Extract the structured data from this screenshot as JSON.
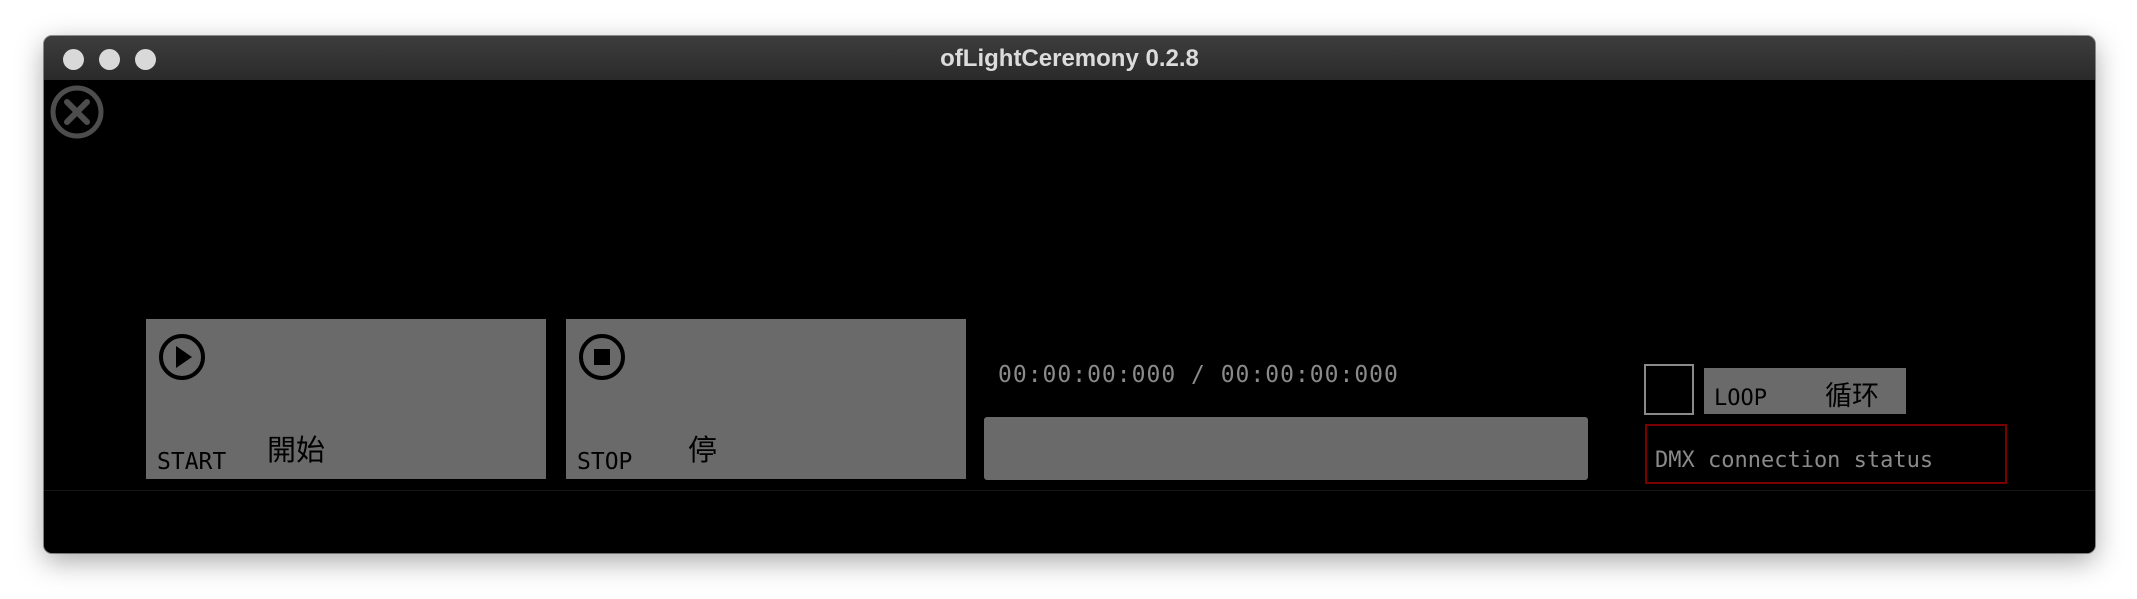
{
  "window": {
    "title": "ofLightCeremony 0.2.8"
  },
  "controls": {
    "start": {
      "label_en": "START",
      "label_cn": "開始",
      "icon": "play-circle-icon"
    },
    "stop": {
      "label_en": "STOP",
      "label_cn": "停",
      "icon": "stop-circle-icon"
    }
  },
  "playback": {
    "time_display": "00:00:00:000 / 00:00:00:000",
    "progress": 0
  },
  "loop": {
    "label_en": "LOOP",
    "label_cn": "循环",
    "checked": false
  },
  "dmx": {
    "status_text": "DMX connection status",
    "border_color": "#7a0000"
  },
  "colors": {
    "background": "#000000",
    "button_fill": "#6a6a6a",
    "text_gray": "#8a8a8a"
  }
}
